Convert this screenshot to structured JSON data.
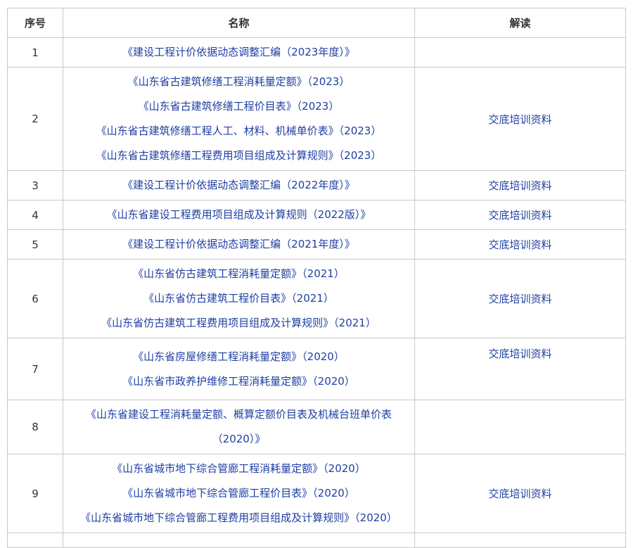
{
  "headers": {
    "index": "序号",
    "name": "名称",
    "note": "解读"
  },
  "rows": [
    {
      "index": "1",
      "lines": [
        "《建设工程计价依据动态调整汇编（2023年度）》"
      ],
      "note": ""
    },
    {
      "index": "2",
      "lines": [
        "《山东省古建筑修缮工程消耗量定额》（2023）",
        "《山东省古建筑修缮工程价目表》（2023）",
        "《山东省古建筑修缮工程人工、材料、机械单价表》（2023）",
        "《山东省古建筑修缮工程费用项目组成及计算规则》（2023）"
      ],
      "note": "交底培训资料"
    },
    {
      "index": "3",
      "lines": [
        "《建设工程计价依据动态调整汇编（2022年度）》"
      ],
      "note": "交底培训资料"
    },
    {
      "index": "4",
      "lines": [
        "《山东省建设工程费用项目组成及计算规则（2022版）》"
      ],
      "note": "交底培训资料"
    },
    {
      "index": "5",
      "lines": [
        "《建设工程计价依据动态调整汇编（2021年度）》"
      ],
      "note": "交底培训资料"
    },
    {
      "index": "6",
      "lines": [
        "《山东省仿古建筑工程消耗量定额》（2021）",
        "《山东省仿古建筑工程价目表》（2021）",
        "《山东省仿古建筑工程费用项目组成及计算规则》（2021）"
      ],
      "note": "交底培训资料"
    },
    {
      "index": "7",
      "lines": [
        "《山东省房屋修缮工程消耗量定额》（2020）",
        "《山东省市政养护维修工程消耗量定额》（2020）"
      ],
      "note": "交底培训资料"
    },
    {
      "index": "8",
      "lines": [
        "《山东省建设工程消耗量定额、概算定额价目表及机械台班单价表",
        "（2020）》"
      ],
      "note": ""
    },
    {
      "index": "9",
      "lines": [
        "《山东省城市地下综合管廊工程消耗量定额》（2020）",
        "《山东省城市地下综合管廊工程价目表》（2020）",
        "《山东省城市地下综合管廊工程费用项目组成及计算规则》（2020）"
      ],
      "note": "交底培训资料"
    }
  ]
}
